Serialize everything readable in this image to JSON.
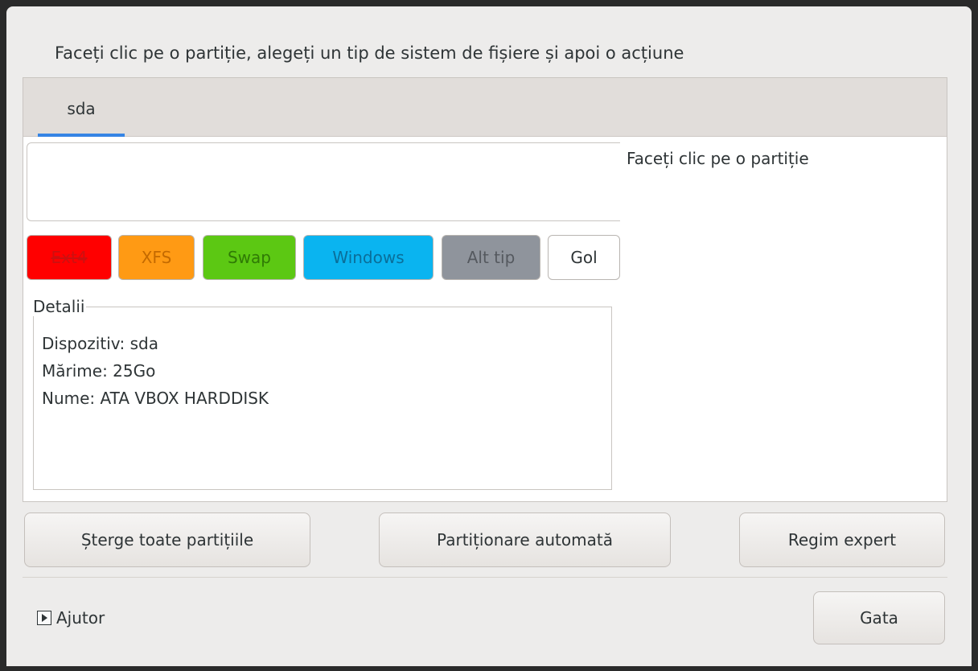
{
  "instruction": "Faceți clic pe o partiție, alegeți un tip de sistem de fișiere și apoi o acțiune",
  "tabs": [
    {
      "label": "sda",
      "active": true
    }
  ],
  "side_hint": "Faceți clic pe o partiție",
  "fs_types": [
    {
      "label": "Ext4",
      "bg": "#ff0000",
      "fg": "#cc1010",
      "icon": "",
      "strike": true
    },
    {
      "label": "XFS",
      "bg": "#ff9a14",
      "fg": "#c46a00"
    },
    {
      "label": "Swap",
      "bg": "#5cc813",
      "fg": "#2f7a05"
    },
    {
      "label": "Windows",
      "bg": "#0ab4f0",
      "fg": "#0a6e99"
    },
    {
      "label": "Alt tip",
      "bg": "#8f949c",
      "fg": "#55595f"
    },
    {
      "label": "Gol",
      "bg": "#ffffff",
      "fg": "#2e3436"
    }
  ],
  "details": {
    "legend": "Detalii",
    "device": "Dispozitiv: sda",
    "size": "Mărime: 25Go",
    "name": "Nume: ATA VBOX HARDDISK"
  },
  "actions": {
    "delete_all": "Șterge toate partițiile",
    "auto": "Partiționare automată",
    "expert": "Regim expert"
  },
  "help_label": "Ajutor",
  "done_label": "Gata"
}
